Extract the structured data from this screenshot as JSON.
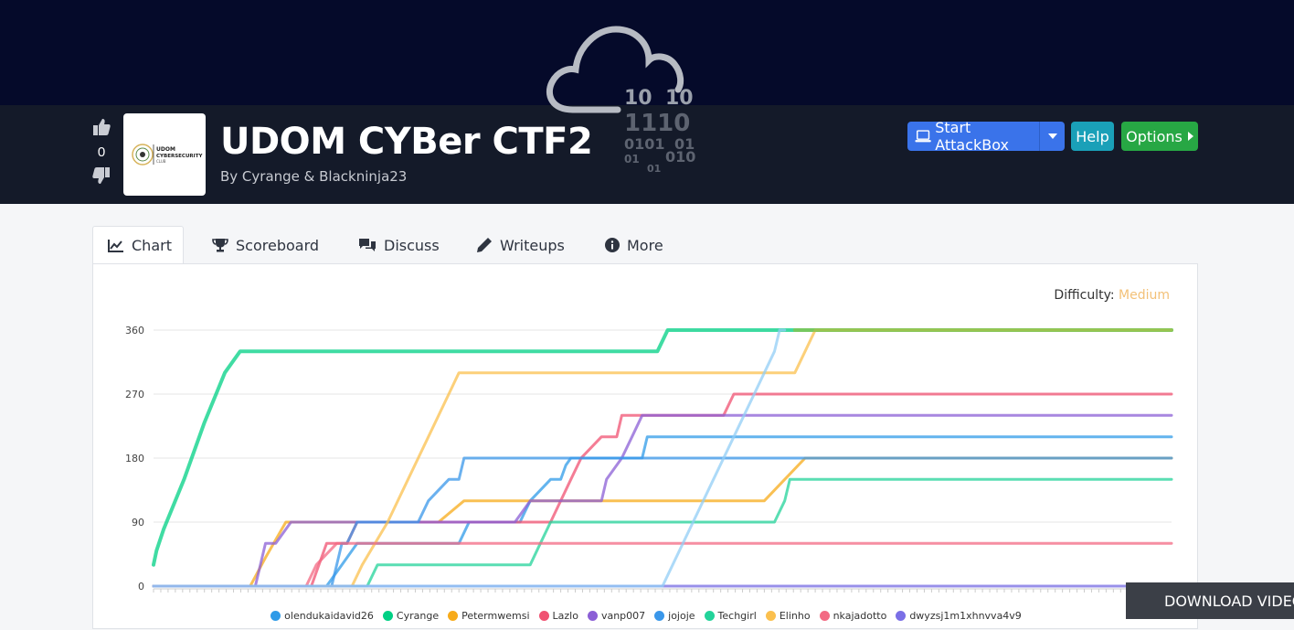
{
  "room": {
    "title": "UDOM CYBer CTF2",
    "author": "By Cyrange & Blackninja23",
    "votes": "0",
    "logo_text_1": "UDOM",
    "logo_text_2": "CYBERSECURITY",
    "logo_text_3": "CLUB"
  },
  "hero_binary": [
    "10",
    "10",
    "1110",
    "0101",
    "01",
    "01",
    "010",
    "01"
  ],
  "actions": {
    "attackbox_label": "Start AttackBox",
    "help_label": "Help",
    "options_label": "Options"
  },
  "tabs": [
    {
      "label": "Chart",
      "icon": "chart-line-icon",
      "active": true
    },
    {
      "label": "Scoreboard",
      "icon": "trophy-icon",
      "active": false
    },
    {
      "label": "Discuss",
      "icon": "comments-icon",
      "active": false
    },
    {
      "label": "Writeups",
      "icon": "pen-icon",
      "active": false
    },
    {
      "label": "More",
      "icon": "info-circle-icon",
      "active": false
    }
  ],
  "difficulty": {
    "label": "Difficulty:",
    "value": "Medium"
  },
  "download_video": "DOWNLOAD VIDEO",
  "colors": {
    "hero_bg": "#050a2a",
    "band_bg": "#141a29",
    "attackbox": "#3a73ea",
    "help": "#1aa0b8",
    "options": "#27a744",
    "medium": "#f3c178"
  },
  "chart_data": {
    "type": "line",
    "xlabel": "",
    "ylabel": "",
    "ylim": [
      0,
      360
    ],
    "yticks": [
      0,
      90,
      180,
      270,
      360
    ],
    "xlim": [
      0,
      100
    ],
    "grid": true,
    "legend": "bottom",
    "series": [
      {
        "name": "olendukaidavid26",
        "color": "#2f9be8",
        "width": 3,
        "points": [
          [
            0,
            0
          ],
          [
            17,
            0
          ],
          [
            18.5,
            30
          ],
          [
            20,
            60
          ],
          [
            30,
            60
          ],
          [
            31,
            90
          ],
          [
            36,
            90
          ],
          [
            37,
            120
          ],
          [
            39,
            150
          ],
          [
            40,
            150
          ],
          [
            40.5,
            170
          ],
          [
            41,
            180
          ],
          [
            48,
            180
          ],
          [
            48.5,
            210
          ],
          [
            100,
            210
          ]
        ]
      },
      {
        "name": "Cyrange",
        "color": "#00d084",
        "width": 4,
        "points": [
          [
            0,
            30
          ],
          [
            0.3,
            50
          ],
          [
            1,
            80
          ],
          [
            3,
            150
          ],
          [
            5,
            230
          ],
          [
            7,
            300
          ],
          [
            8.5,
            330
          ],
          [
            49.5,
            330
          ],
          [
            50.5,
            360
          ],
          [
            100,
            360
          ]
        ]
      },
      {
        "name": "Petermwemsi",
        "color": "#f7ab1a",
        "width": 3,
        "points": [
          [
            0,
            0
          ],
          [
            9.5,
            0
          ],
          [
            11,
            40
          ],
          [
            13,
            90
          ],
          [
            27,
            90
          ],
          [
            28,
            90
          ],
          [
            30.5,
            120
          ],
          [
            31,
            120
          ],
          [
            60,
            120
          ],
          [
            62,
            150
          ],
          [
            64,
            180
          ],
          [
            100,
            180
          ]
        ]
      },
      {
        "name": "Lazlo",
        "color": "#f05272",
        "width": 3,
        "points": [
          [
            0,
            0
          ],
          [
            15.5,
            0
          ],
          [
            17,
            60
          ],
          [
            19,
            60
          ],
          [
            20,
            90
          ],
          [
            32,
            90
          ],
          [
            32.5,
            90
          ],
          [
            39,
            90
          ],
          [
            41,
            150
          ],
          [
            42,
            180
          ],
          [
            44,
            210
          ],
          [
            45.5,
            210
          ],
          [
            46,
            240
          ],
          [
            56,
            240
          ],
          [
            57,
            270
          ],
          [
            100,
            270
          ]
        ]
      },
      {
        "name": "vanp007",
        "color": "#8b5fd6",
        "width": 3,
        "points": [
          [
            0,
            0
          ],
          [
            10,
            0
          ],
          [
            11,
            60
          ],
          [
            12,
            60
          ],
          [
            13.5,
            90
          ],
          [
            35,
            90
          ],
          [
            35.5,
            90
          ],
          [
            37,
            120
          ],
          [
            44,
            120
          ],
          [
            44.5,
            150
          ],
          [
            46,
            180
          ],
          [
            47,
            210
          ],
          [
            48,
            240
          ],
          [
            60,
            240
          ],
          [
            100,
            240
          ]
        ]
      },
      {
        "name": "jojoje",
        "color": "#3a97ea",
        "width": 3,
        "points": [
          [
            0,
            0
          ],
          [
            17.5,
            0
          ],
          [
            18.5,
            60
          ],
          [
            19,
            60
          ],
          [
            20,
            90
          ],
          [
            21,
            90
          ],
          [
            26,
            90
          ],
          [
            27,
            120
          ],
          [
            29,
            150
          ],
          [
            30,
            150
          ],
          [
            30.5,
            180
          ],
          [
            100,
            180
          ]
        ]
      },
      {
        "name": "Techgirl",
        "color": "#23d39a",
        "width": 3,
        "points": [
          [
            0,
            0
          ],
          [
            21,
            0
          ],
          [
            22,
            30
          ],
          [
            37,
            30
          ],
          [
            38,
            60
          ],
          [
            39,
            90
          ],
          [
            61,
            90
          ],
          [
            62,
            120
          ],
          [
            62.5,
            150
          ],
          [
            100,
            150
          ]
        ]
      },
      {
        "name": "Elinho",
        "color": "#fbc04e",
        "width": 3,
        "points": [
          [
            0,
            0
          ],
          [
            19.5,
            0
          ],
          [
            20.5,
            30
          ],
          [
            23,
            90
          ],
          [
            25,
            150
          ],
          [
            27,
            210
          ],
          [
            29,
            270
          ],
          [
            30,
            300
          ],
          [
            63,
            300
          ],
          [
            64,
            330
          ],
          [
            65,
            360
          ],
          [
            100,
            360
          ]
        ]
      },
      {
        "name": "nkajadotto",
        "color": "#f36a83",
        "width": 3,
        "points": [
          [
            0,
            0
          ],
          [
            15,
            0
          ],
          [
            16,
            30
          ],
          [
            18,
            60
          ],
          [
            40,
            60
          ],
          [
            41,
            60
          ],
          [
            100,
            60
          ]
        ]
      },
      {
        "name": "dwyzsj1m1xhnvva4v9",
        "color": "#7a6fe6",
        "width": 3,
        "points": [
          [
            0,
            0
          ],
          [
            100,
            0
          ]
        ]
      },
      {
        "name": "",
        "color": "#92cdf5",
        "width": 3,
        "points": [
          [
            0,
            0
          ],
          [
            50,
            0
          ],
          [
            51,
            30
          ],
          [
            53,
            90
          ],
          [
            55,
            150
          ],
          [
            57,
            210
          ],
          [
            59,
            270
          ],
          [
            61,
            330
          ],
          [
            61.5,
            360
          ],
          [
            62,
            360
          ]
        ]
      },
      {
        "name": "",
        "color": "#8ac24a",
        "width": 4,
        "points": [
          [
            63,
            360
          ],
          [
            100,
            360
          ]
        ]
      }
    ]
  }
}
